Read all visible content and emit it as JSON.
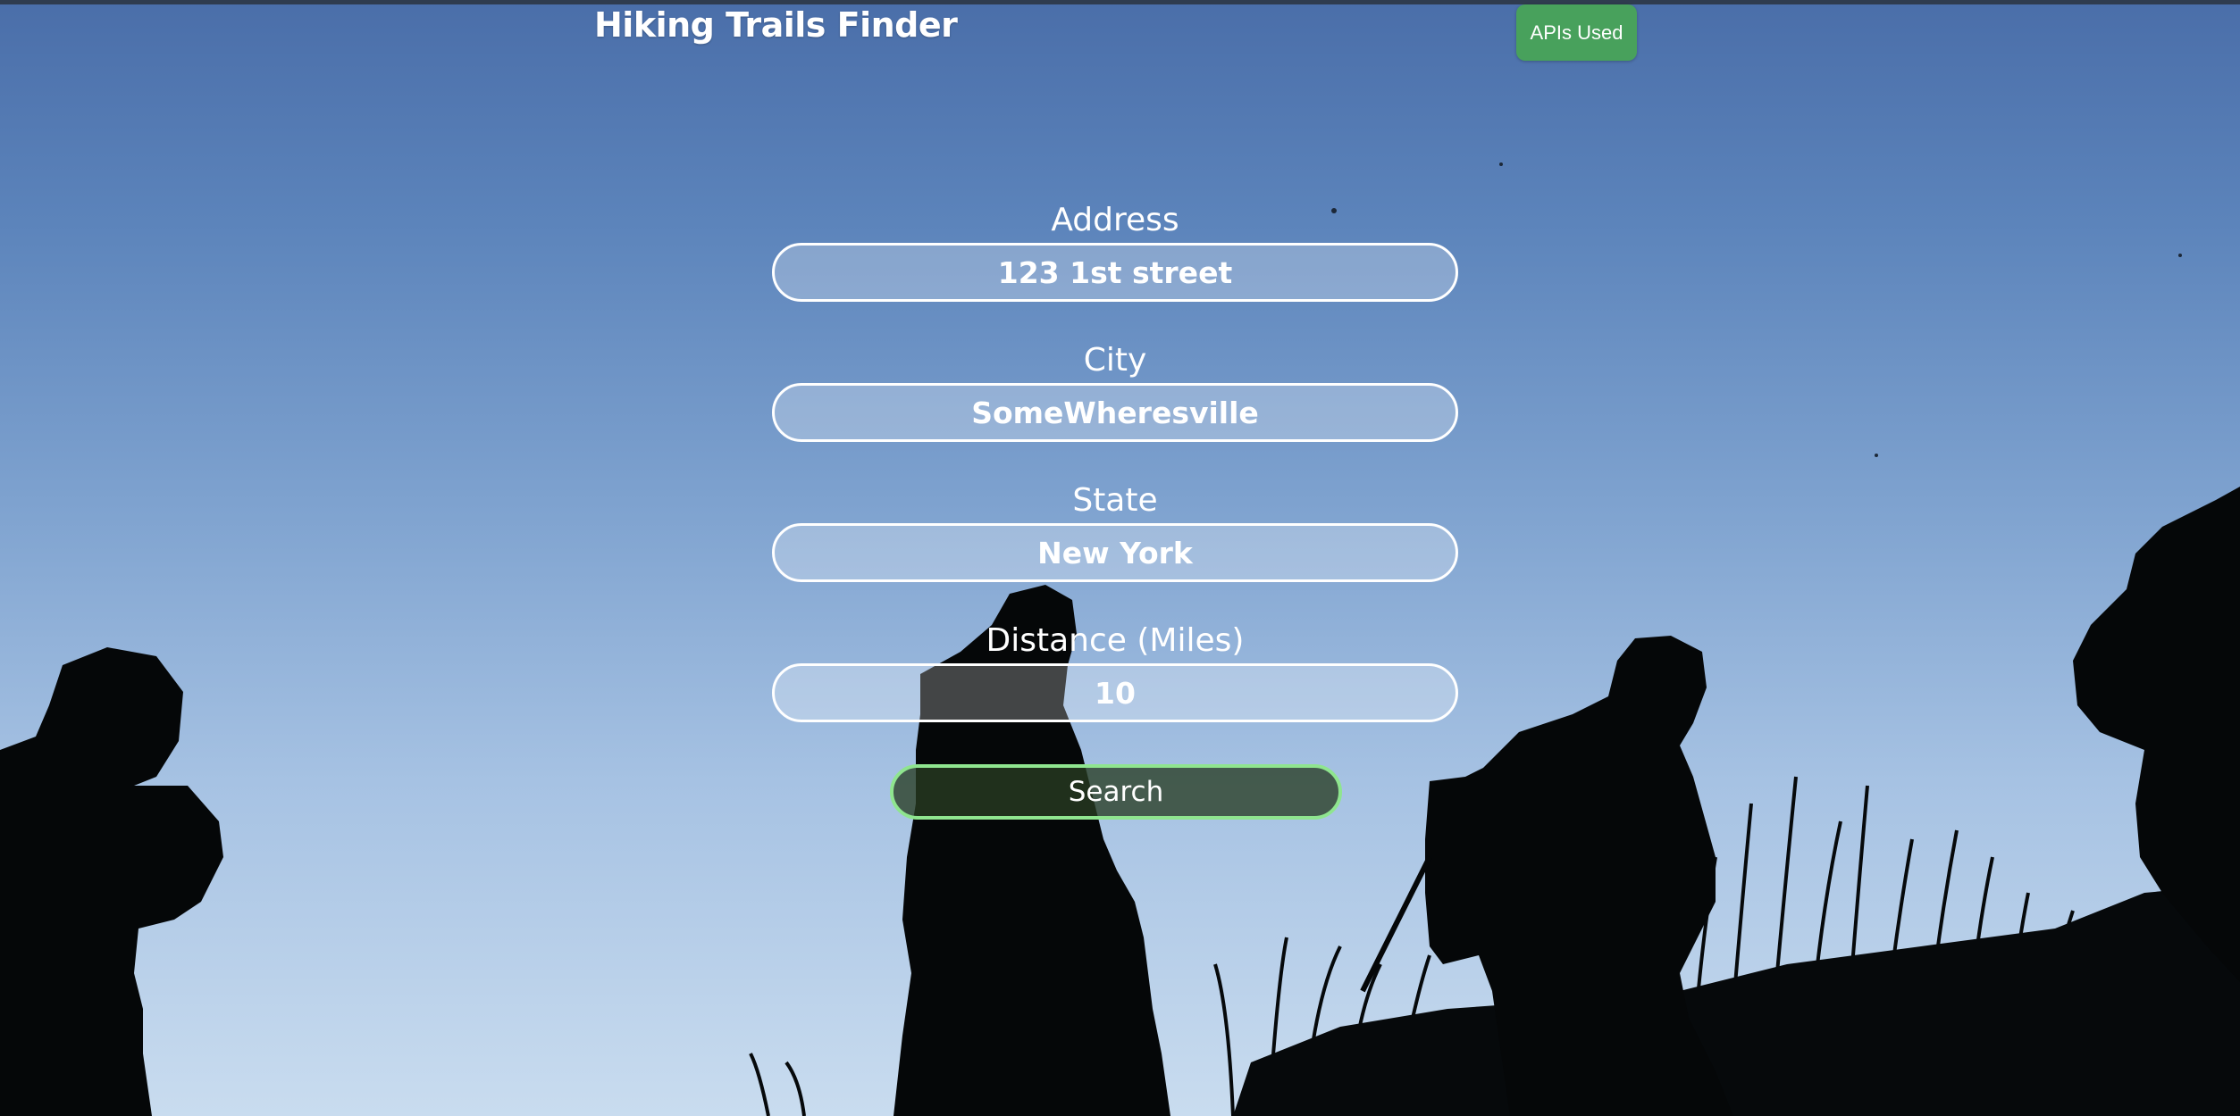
{
  "app": {
    "title": "Hiking Trails Finder",
    "apis_button_label": "APIs Used"
  },
  "form": {
    "fields": [
      {
        "label": "Address",
        "value": "123 1st street"
      },
      {
        "label": "City",
        "value": "SomeWheresville"
      },
      {
        "label": "State",
        "value": "New York"
      },
      {
        "label": "Distance (Miles)",
        "value": "10"
      }
    ],
    "search_label": "Search"
  },
  "colors": {
    "sky_top": "#4a6ea9",
    "sky_bottom": "#c9dcef",
    "apis_button": "#48a15c",
    "search_border": "#8fe58f",
    "silhouette": "#050708"
  },
  "background": {
    "description_icon": "hikers-silhouette-photo"
  }
}
